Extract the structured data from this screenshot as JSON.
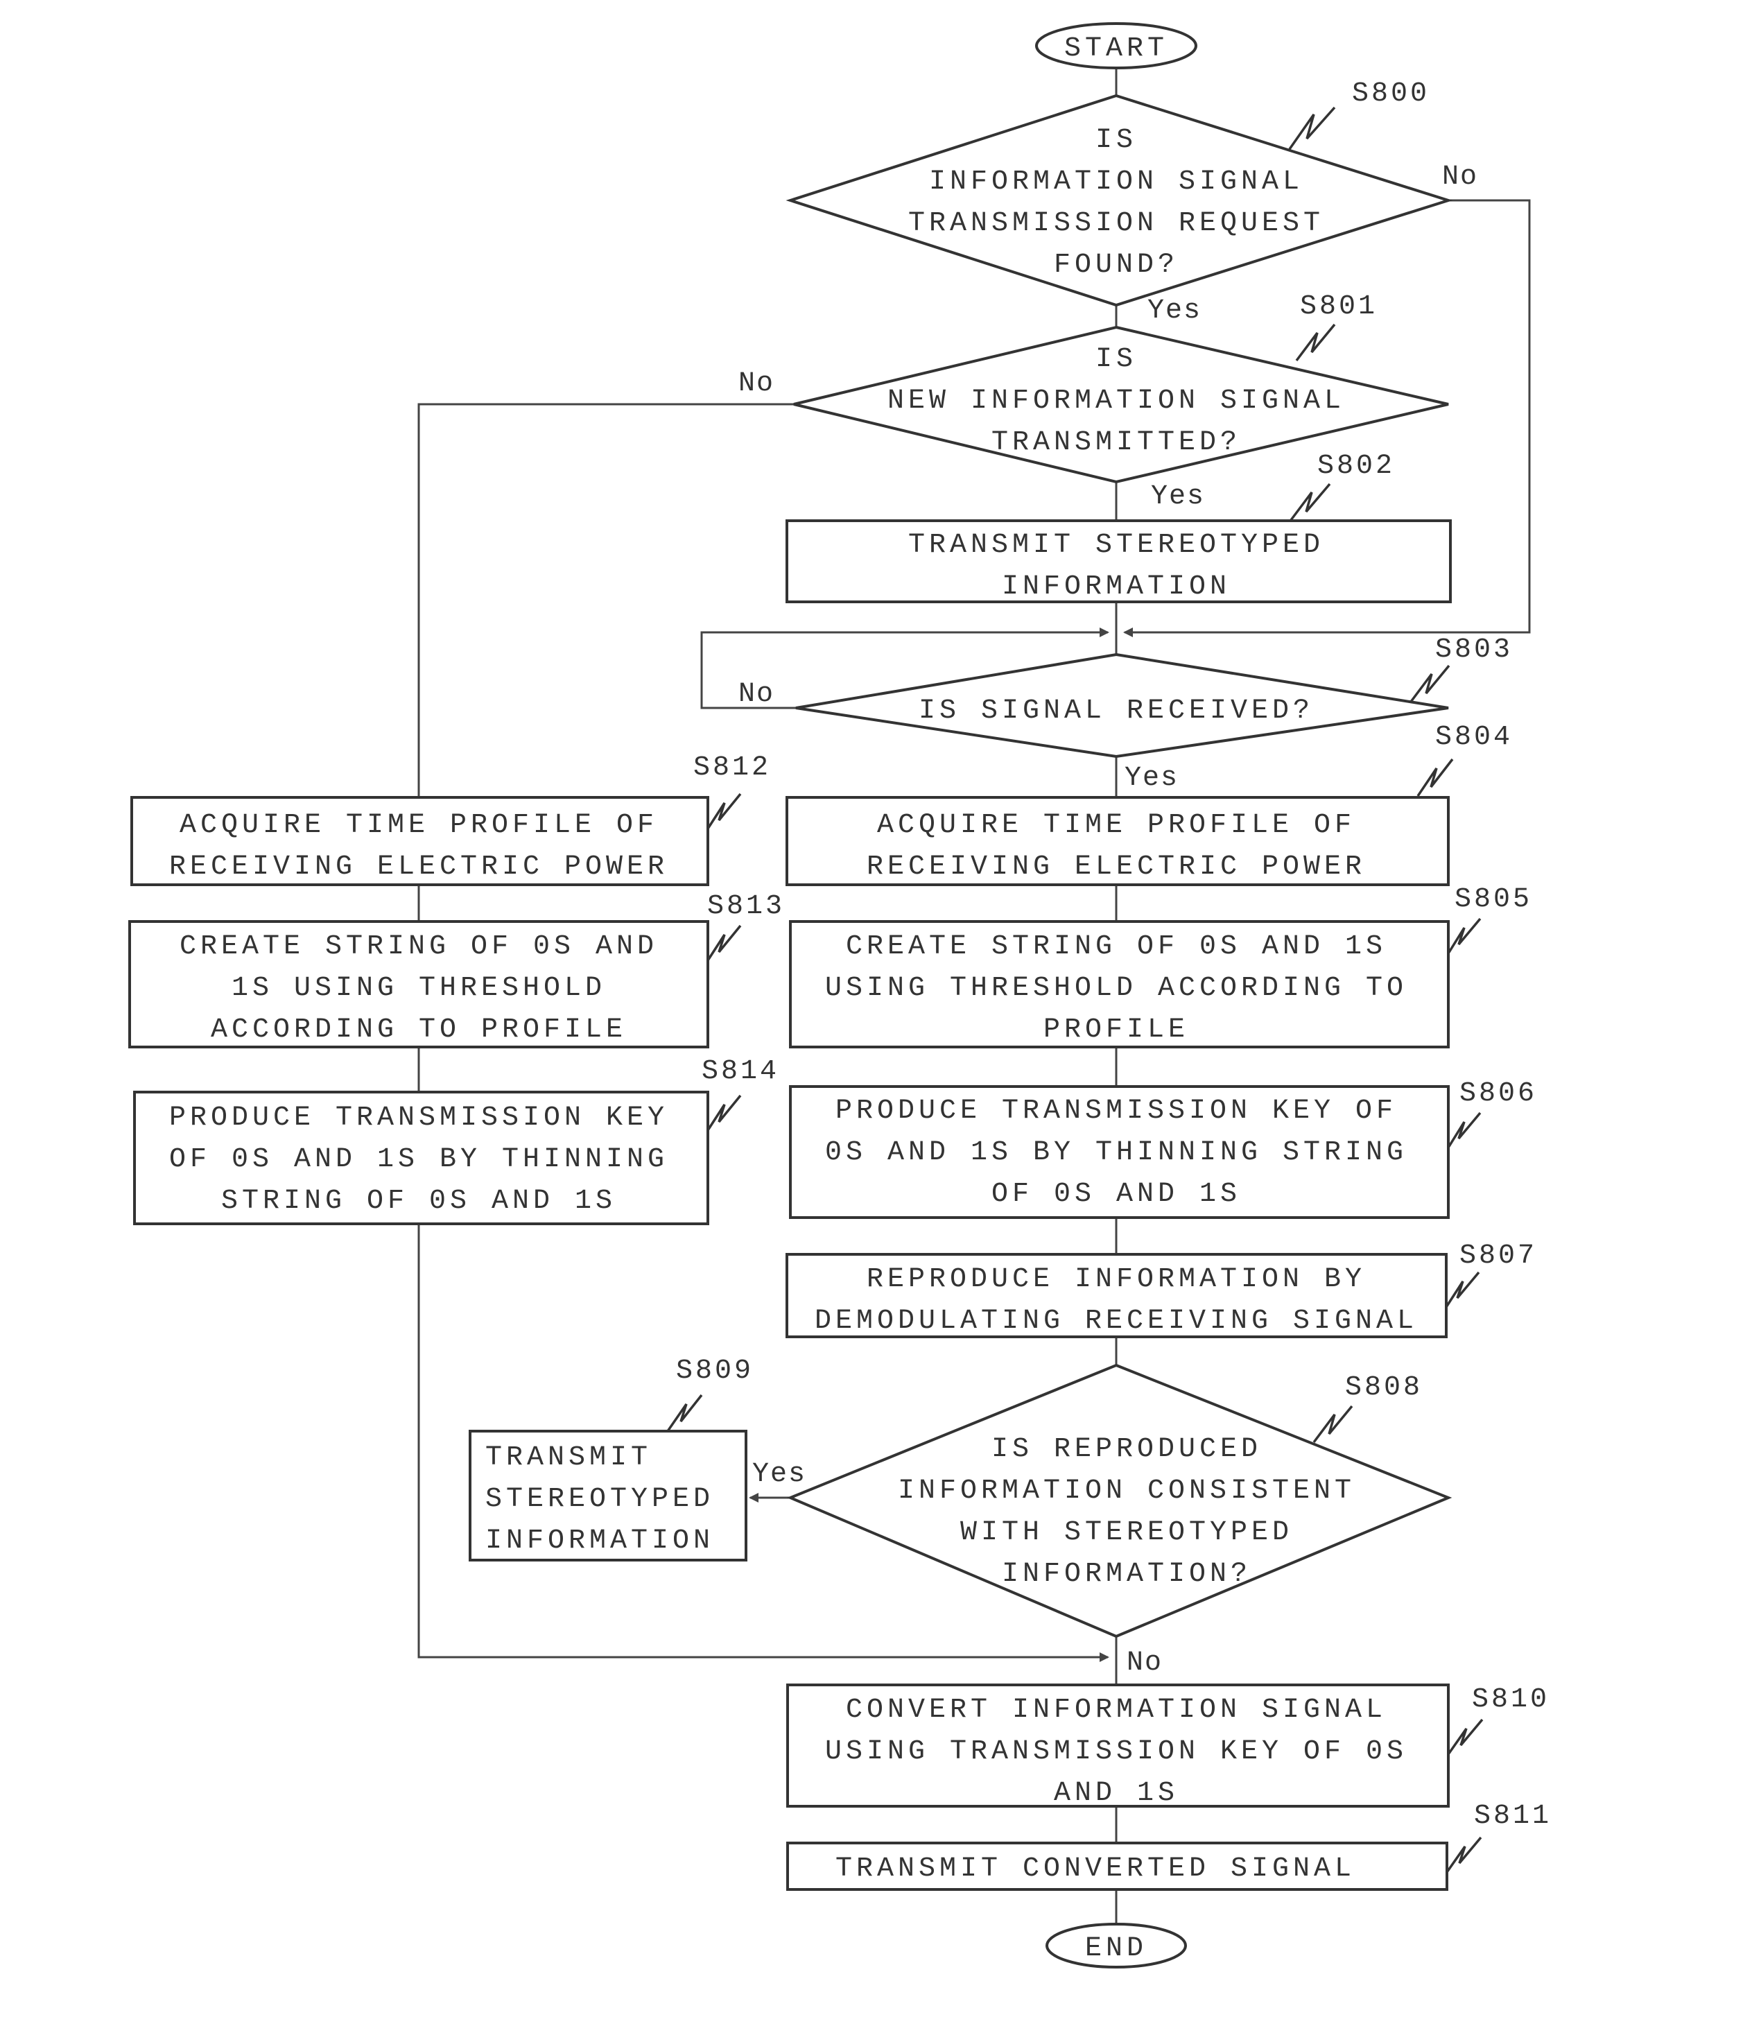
{
  "terminals": {
    "start": "START",
    "end": "END"
  },
  "steps": {
    "S800": {
      "label": "S800",
      "lines": [
        "IS",
        "INFORMATION SIGNAL",
        "TRANSMISSION REQUEST",
        "FOUND?"
      ],
      "yes": "Yes",
      "no": "No"
    },
    "S801": {
      "label": "S801",
      "lines": [
        "IS",
        "NEW INFORMATION SIGNAL",
        "TRANSMITTED?"
      ],
      "yes": "Yes",
      "no": "No"
    },
    "S802": {
      "label": "S802",
      "lines": [
        "TRANSMIT STEREOTYPED",
        "INFORMATION"
      ]
    },
    "S803": {
      "label": "S803",
      "lines": [
        "IS SIGNAL RECEIVED?"
      ],
      "yes": "Yes",
      "no": "No"
    },
    "S804": {
      "label": "S804",
      "lines": [
        "ACQUIRE TIME PROFILE OF",
        "RECEIVING ELECTRIC POWER"
      ]
    },
    "S805": {
      "label": "S805",
      "lines": [
        "CREATE STRING OF 0S AND 1S",
        "USING THRESHOLD ACCORDING TO",
        "PROFILE"
      ]
    },
    "S806": {
      "label": "S806",
      "lines": [
        "PRODUCE TRANSMISSION KEY OF",
        "0S AND 1S BY THINNING STRING",
        "OF 0S AND 1S"
      ]
    },
    "S807": {
      "label": "S807",
      "lines": [
        "REPRODUCE INFORMATION BY",
        "DEMODULATING RECEIVING SIGNAL"
      ]
    },
    "S808": {
      "label": "S808",
      "lines": [
        "IS REPRODUCED",
        "INFORMATION CONSISTENT",
        "WITH STEREOTYPED",
        "INFORMATION?"
      ],
      "yes": "Yes",
      "no": "No"
    },
    "S809": {
      "label": "S809",
      "lines": [
        "TRANSMIT",
        "STEREOTYPED",
        "INFORMATION"
      ]
    },
    "S810": {
      "label": "S810",
      "lines": [
        "CONVERT INFORMATION SIGNAL",
        "USING TRANSMISSION KEY OF 0S",
        "AND 1S"
      ]
    },
    "S811": {
      "label": "S811",
      "lines": [
        "TRANSMIT CONVERTED SIGNAL"
      ]
    },
    "S812": {
      "label": "S812",
      "lines": [
        "ACQUIRE TIME PROFILE OF",
        "RECEIVING ELECTRIC POWER"
      ]
    },
    "S813": {
      "label": "S813",
      "lines": [
        "CREATE STRING OF 0S AND",
        "1S USING THRESHOLD",
        "ACCORDING TO PROFILE"
      ]
    },
    "S814": {
      "label": "S814",
      "lines": [
        "PRODUCE TRANSMISSION KEY",
        "OF 0S AND 1S BY THINNING",
        "STRING OF 0S AND 1S"
      ]
    }
  }
}
